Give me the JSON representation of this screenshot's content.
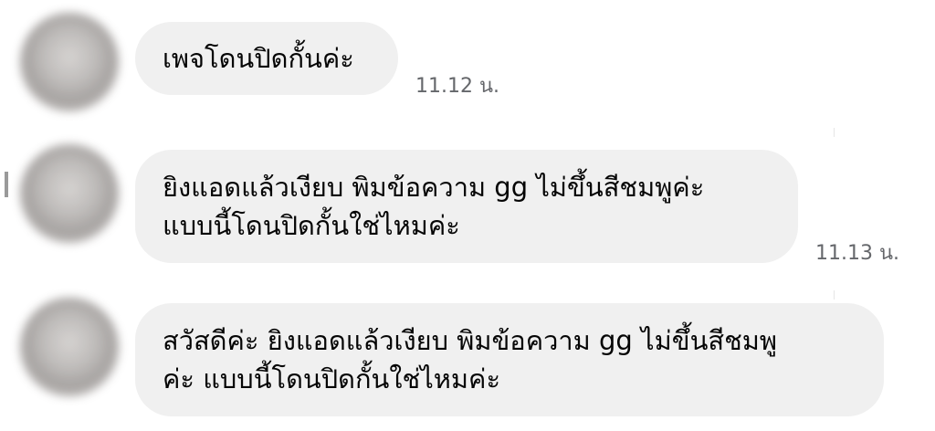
{
  "messages": [
    {
      "text": "เพจโดนปิดกั้นค่ะ",
      "time": "11.12 น."
    },
    {
      "text": "ยิงแอดแล้วเงียบ  พิมข้อความ gg ไม่ขึ้นสีชมพูค่ะ\nแบบนี้โดนปิดกั้นใช่ไหมค่ะ",
      "time": "11.13 น."
    },
    {
      "text": "สวัสดีค่ะ ยิงแอดแล้วเงียบ  พิมข้อความ gg ไม่ขึ้นสีชมพู\nค่ะ แบบนี้โดนปิดกั้นใช่ไหมค่ะ",
      "time": ""
    }
  ],
  "colors": {
    "bubble_bg": "#f0f0f0",
    "text": "#050505",
    "timestamp": "#65676b"
  }
}
